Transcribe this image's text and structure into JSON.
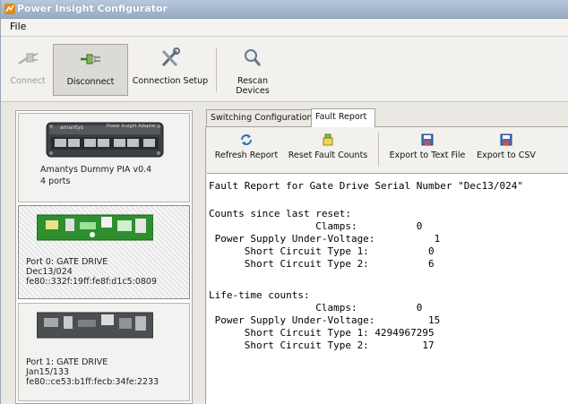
{
  "window": {
    "title": "Power Insight Configurator"
  },
  "menu": {
    "file": "File"
  },
  "toolbar": {
    "connect": "Connect",
    "disconnect": "Disconnect",
    "connection_setup": "Connection Setup",
    "rescan": "Rescan Devices"
  },
  "adapter": {
    "name": "Amantys Dummy PIA  v0.4",
    "ports": "4 ports",
    "brand": "amantys",
    "label": "Power Insight Adapter"
  },
  "port_cards": [
    {
      "line1": "Port 0: GATE DRIVE",
      "line2": "Dec13/024",
      "line3": "fe80::332f:19ff:fe8f:d1c5:0809"
    },
    {
      "line1": "Port 1: GATE DRIVE",
      "line2": "Jan15/133",
      "line3": "fe80::ce53:b1ff:fecb:34fe:2233"
    }
  ],
  "tabs": {
    "switching": "Switching Configuration",
    "fault": "Fault Report"
  },
  "report_toolbar": {
    "refresh": "Refresh Report",
    "reset": "Reset Fault Counts",
    "export_text": "Export to Text File",
    "export_csv": "Export to CSV"
  },
  "report": {
    "header": "Fault Report for Gate Drive Serial Number \"Dec13/024\"",
    "since_reset_title": "Counts since last reset:",
    "since_reset": [
      "                  Clamps:          0",
      " Power Supply Under-Voltage:          1",
      "      Short Circuit Type 1:          0",
      "      Short Circuit Type 2:          6"
    ],
    "lifetime_title": "Life-time counts:",
    "lifetime": [
      "                  Clamps:          0",
      " Power Supply Under-Voltage:         15",
      "      Short Circuit Type 1: 4294967295",
      "      Short Circuit Type 2:         17"
    ]
  },
  "colors": {
    "title_gradient_top": "#b8c8db",
    "pcb_green": "#2f8f2f",
    "window_bg": "#eae8e3"
  }
}
